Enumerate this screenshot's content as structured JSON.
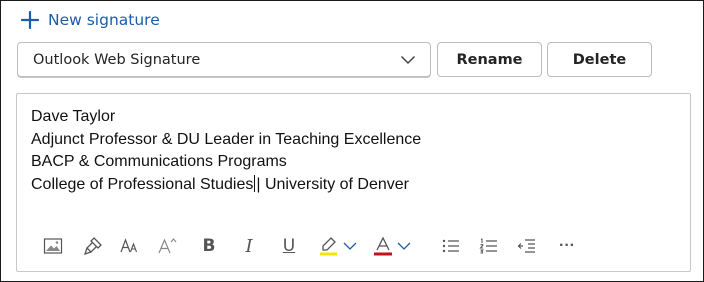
{
  "header": {
    "new_signature_label": "New signature"
  },
  "signature_select": {
    "selected": "Outlook Web Signature"
  },
  "actions": {
    "rename_label": "Rename",
    "delete_label": "Delete"
  },
  "editor": {
    "lines": [
      "Dave Taylor",
      "Adjunct Professor & DU Leader in Teaching Excellence",
      "BACP & Communications Programs",
      "College of Professional Studies",
      "| University of Denver"
    ]
  },
  "toolbar": {
    "icons": [
      "insert-image-icon",
      "format-painter-icon",
      "font-size-icon",
      "increase-font-size-icon",
      "bold-icon",
      "italic-icon",
      "underline-icon",
      "highlight-icon",
      "font-color-icon",
      "bullets-icon",
      "numbering-icon",
      "decrease-indent-icon",
      "more-options-icon"
    ],
    "bold_glyph": "B",
    "italic_glyph": "I",
    "underline_glyph": "U",
    "more_glyph": "···"
  },
  "colors": {
    "accent": "#1b5ea5",
    "highlight": "#f2e600",
    "font_color": "#c50f1f"
  }
}
